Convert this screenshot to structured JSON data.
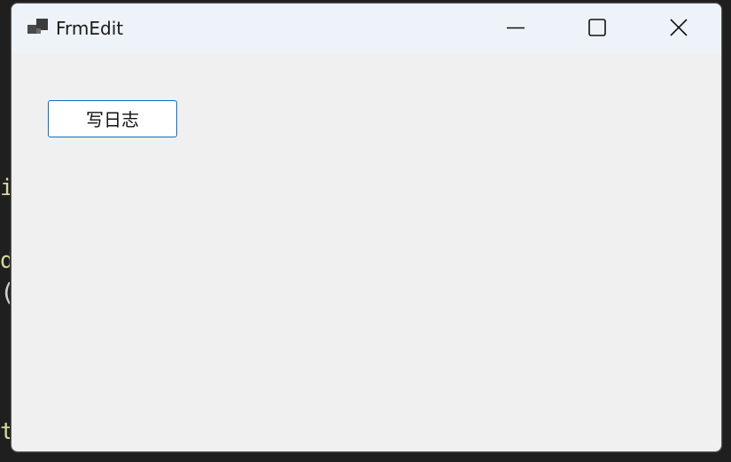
{
  "window": {
    "title": "FrmEdit",
    "icon": "app-form-icon"
  },
  "controls": {
    "minimize_icon": "minimize-icon",
    "maximize_icon": "maximize-icon",
    "close_icon": "close-icon"
  },
  "main": {
    "write_log_button_label": "写日志"
  },
  "background_code": {
    "line1": "i",
    "line2": "d",
    "line3": "(",
    "line4": "t"
  },
  "colors": {
    "titlebar_bg": "#edf3f8",
    "client_bg": "#f0f0f0",
    "button_border": "#0f6cbd"
  }
}
